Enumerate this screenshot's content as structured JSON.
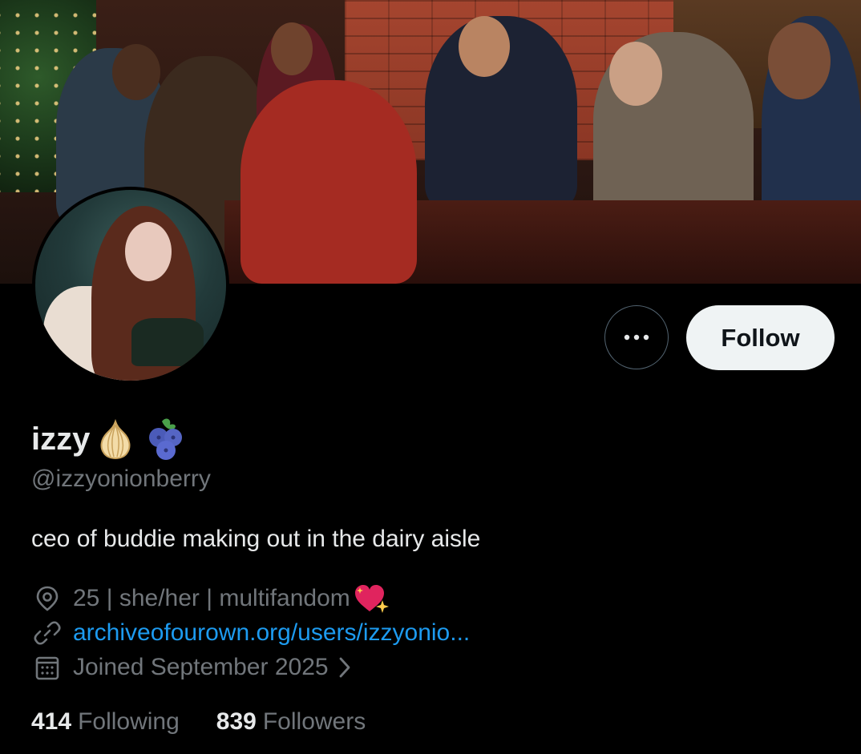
{
  "profile": {
    "display_name": "izzy",
    "handle": "@izzyonionberry",
    "bio": "ceo of buddie making out in the dairy aisle",
    "location": "25 | she/her | multifandom",
    "website": "archiveofourown.org/users/izzyonio...",
    "joined": "Joined September 2025",
    "following_count": "414",
    "following_label": "Following",
    "followers_count": "839",
    "followers_label": "Followers"
  },
  "actions": {
    "follow_label": "Follow"
  },
  "icons": {
    "name_emoji_1": "onion-icon",
    "name_emoji_2": "blueberry-icon",
    "location_emoji": "sparkling-heart-icon",
    "location": "location-pin-icon",
    "link": "link-icon",
    "calendar": "calendar-icon",
    "chevron": "chevron-right-icon",
    "more": "more-dots-icon"
  },
  "colors": {
    "background": "#000000",
    "primary_text": "#e7e9ea",
    "secondary_text": "#71767b",
    "link": "#1d9bf0",
    "follow_button_bg": "#eff3f4",
    "follow_button_text": "#0f1419"
  }
}
